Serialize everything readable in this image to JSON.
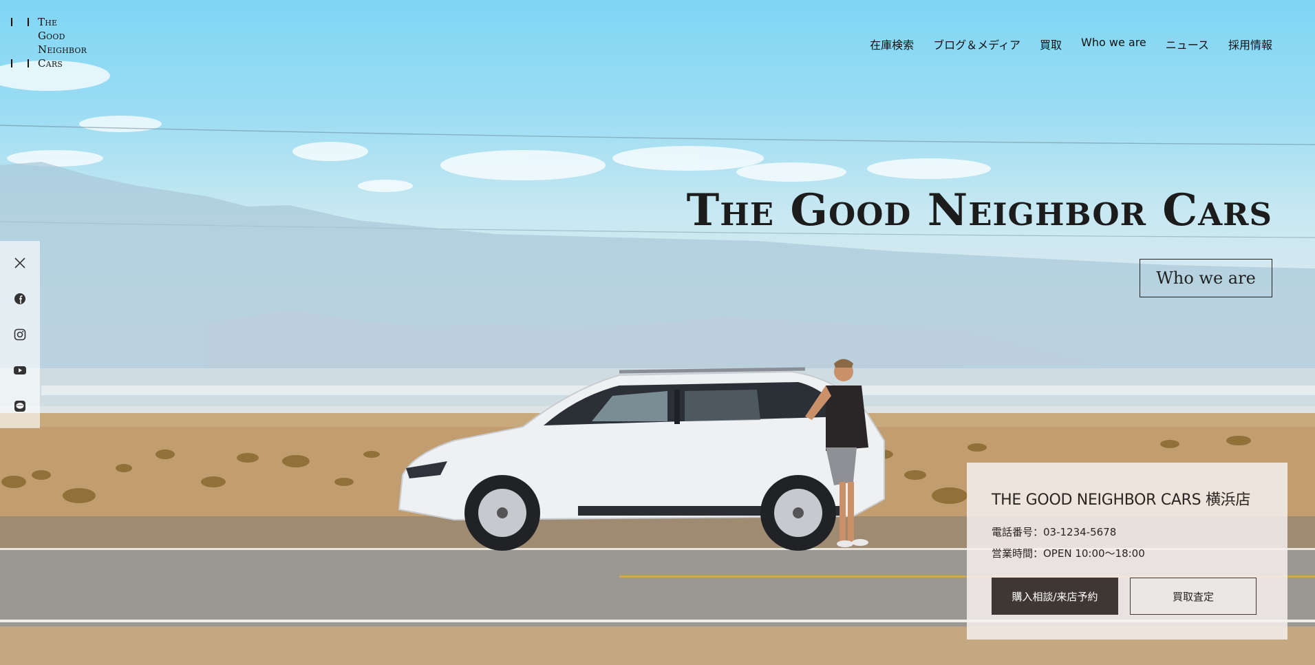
{
  "logo": {
    "line1": "The",
    "line2": "Good",
    "line3": "Neighbor",
    "line4": "Cars"
  },
  "nav": {
    "items": [
      {
        "label": "在庫検索"
      },
      {
        "label": "ブログ＆メディア"
      },
      {
        "label": "買取"
      },
      {
        "label": "Who we are"
      },
      {
        "label": "ニュース"
      },
      {
        "label": "採用情報"
      }
    ]
  },
  "hero": {
    "title": "The Good Neighbor Cars",
    "cta_label": "Who we are"
  },
  "social": {
    "icons": [
      "x-icon",
      "facebook-icon",
      "instagram-icon",
      "youtube-icon",
      "line-icon"
    ]
  },
  "store": {
    "name": "THE GOOD NEIGHBOR CARS 横浜店",
    "phone": "電話番号：03-1234-5678",
    "hours": "営業時間：OPEN 10:00〜18:00",
    "button_primary": "購入相談/来店予約",
    "button_secondary": "買取査定"
  },
  "colors": {
    "accent_dark": "#3e3733",
    "card_bg": "#f5f0ec",
    "sky_top": "#7fd6f4"
  }
}
